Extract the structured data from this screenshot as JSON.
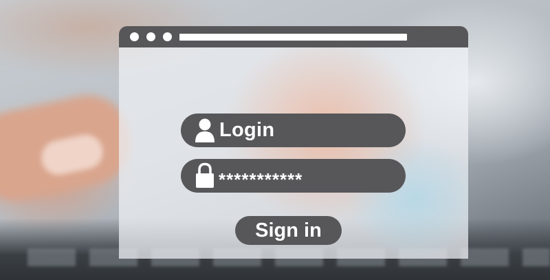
{
  "window": {
    "controls": [
      "window-dot",
      "window-dot",
      "window-dot"
    ]
  },
  "form": {
    "username_label": "Login",
    "username_icon": "user-icon",
    "password_value": "***********",
    "password_icon": "padlock-icon",
    "sign_in_label": "Sign in"
  },
  "colors": {
    "chrome": "#57575a",
    "text": "#ffffff"
  }
}
